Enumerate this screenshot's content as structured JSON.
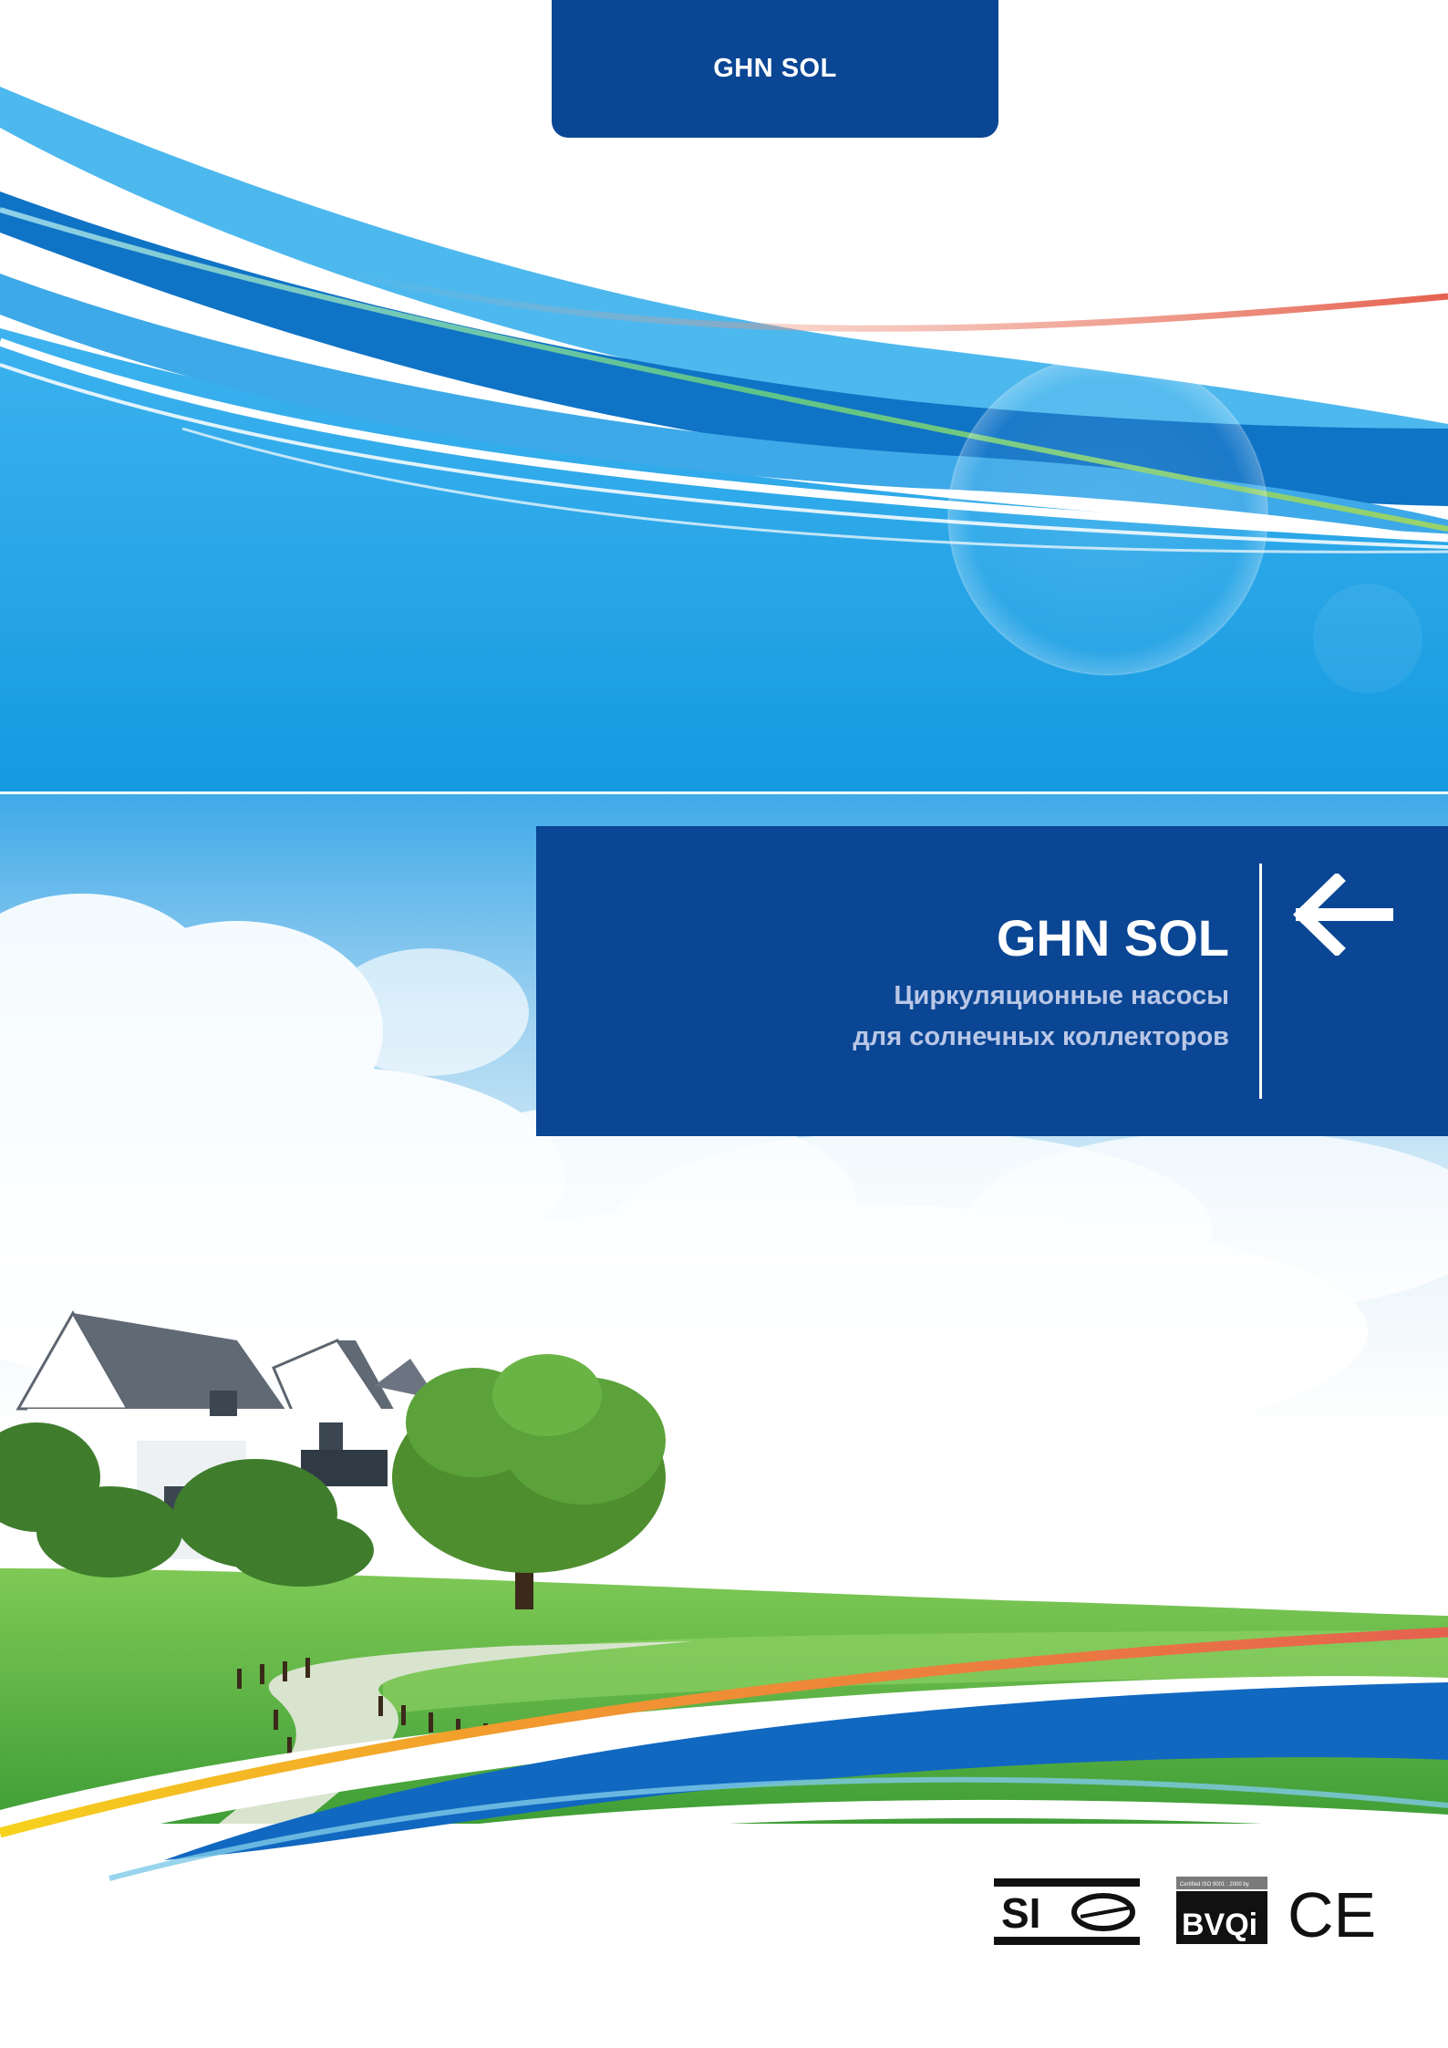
{
  "header": {
    "tab_label": "GHN SOL"
  },
  "title_panel": {
    "title": "GHN SOL",
    "subtitle_line1": "Циркуляционные насосы",
    "subtitle_line2": "для солнечных коллекторов"
  },
  "certifications": {
    "si_label": "SI",
    "iso_caption": "Certified ISO 9001 : 2000 by",
    "bvqi_label": "BVQi",
    "ce_label": "CE"
  },
  "colors": {
    "brand_blue": "#0a4694",
    "sky_blue": "#1ea0e6",
    "grass_green": "#54b548",
    "accent_red": "#e5614f"
  },
  "icons": {
    "back_arrow": "arrow-left-icon"
  }
}
